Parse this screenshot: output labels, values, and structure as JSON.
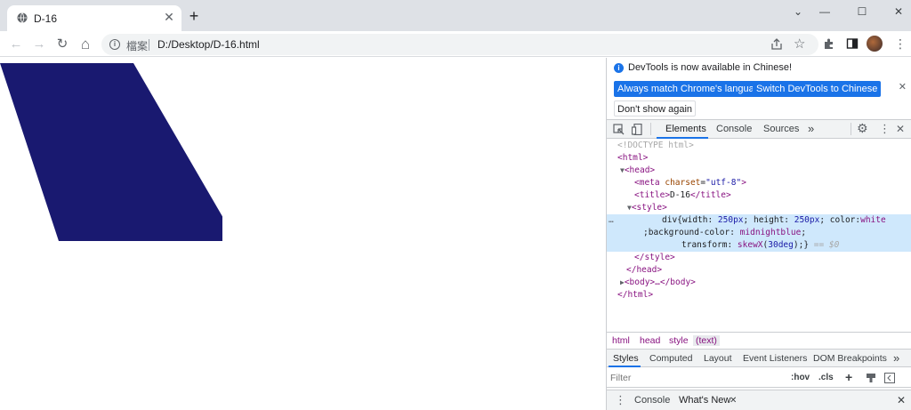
{
  "browser": {
    "tab": {
      "title": "D-16",
      "close_glyph": "✕"
    },
    "new_tab_glyph": "+",
    "window_controls": {
      "minimize": "—",
      "maximize": "☐",
      "close": "✕",
      "collapse": "⌄"
    },
    "toolbar": {
      "back": "←",
      "forward": "→",
      "reload": "↻",
      "home": "⌂"
    },
    "omnibox": {
      "site_label": "檔案",
      "url": "D:/Desktop/D-16.html"
    },
    "icons": [
      "info-icon",
      "share-icon",
      "star-icon",
      "extensions-icon",
      "side-panel-icon",
      "avatar",
      "menu-icon"
    ]
  },
  "page": {
    "div_color": "#191970",
    "skew_deg": 30
  },
  "devtools": {
    "infobar": {
      "message": "DevTools is now available in Chinese!",
      "btn_match": "Always match Chrome's language",
      "btn_switch": "Switch DevTools to Chinese",
      "btn_dont_show": "Don't show again"
    },
    "tabs": [
      "Elements",
      "Console",
      "Sources"
    ],
    "more_tabs": "»",
    "dom": {
      "doctype": "<!DOCTYPE html>",
      "html_open": "<html>",
      "head_open": "<head>",
      "meta_tag": "meta",
      "meta_attr": "charset",
      "meta_val": "\"utf-8\"",
      "title_open": "<title>",
      "title_text": "D-16",
      "title_close": "</title>",
      "style_open": "<style>",
      "css_line1_a": "div{width: ",
      "css_line1_b": "250px",
      "css_line1_c": "; height: ",
      "css_line1_d": "250px",
      "css_line1_e": "; color:",
      "css_line1_f": "white",
      "css_line2_a": ";background-color: ",
      "css_line2_b": "midnightblue",
      "css_line2_c": ";",
      "css_line3_a": "transform: ",
      "css_line3_b": "skewX",
      "css_line3_c": "(",
      "css_line3_d": "30deg",
      "css_line3_e": ");}",
      "css_line3_f": "== $0",
      "style_close": "</style>",
      "head_close": "</head>",
      "body_collapsed": "<body>…</body>",
      "html_close": "</html>",
      "ellipsis": "…"
    },
    "breadcrumbs": [
      "html",
      "head",
      "style",
      "(text)"
    ],
    "pane_tabs": [
      "Styles",
      "Computed",
      "Layout",
      "Event Listeners",
      "DOM Breakpoints"
    ],
    "pane_more": "»",
    "filter": {
      "placeholder": "Filter",
      "hov": ":hov",
      "cls": ".cls",
      "plus": "+"
    },
    "drawer": {
      "tabs": [
        "Console",
        "What's New"
      ],
      "close": "✕",
      "menu": "⋮"
    }
  }
}
